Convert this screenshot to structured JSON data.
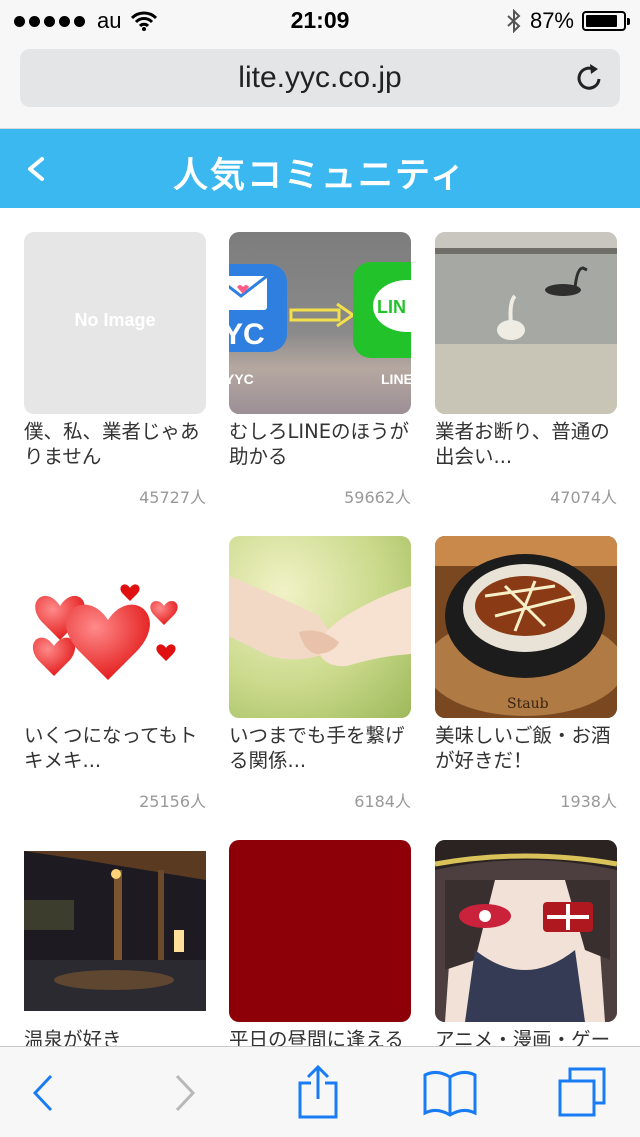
{
  "status": {
    "carrier": "au",
    "time": "21:09",
    "battery": "87%",
    "battery_level": 0.87
  },
  "browser": {
    "url": "lite.yyc.co.jp"
  },
  "header": {
    "title": "人気コミュニティ"
  },
  "communities": [
    {
      "name": "僕、私、業者じゃありません",
      "count": "45727人",
      "image": "no-image",
      "image_text": "No Image"
    },
    {
      "name": "むしろLINEのほうが助かる",
      "count": "59662人",
      "image": "yyc-to-line",
      "yyc_label": "YYC",
      "line_label": "LINE"
    },
    {
      "name": "業者お断り、普通の出会い...",
      "count": "47074人",
      "image": "swans-photo"
    },
    {
      "name": "いくつになってもトキメキ...",
      "count": "25156人",
      "image": "hearts"
    },
    {
      "name": "いつまでも手を繋げる関係...",
      "count": "6184人",
      "image": "holding-hands-photo"
    },
    {
      "name": "美味しいご飯・お酒が好きだ！",
      "count": "1938人",
      "image": "food-photo",
      "pot_text": "Staub"
    },
    {
      "name": "温泉が好き",
      "count": "",
      "image": "onsen-photo"
    },
    {
      "name": "平日の昼間に逢える",
      "count": "",
      "image": "dark-red"
    },
    {
      "name": "アニメ・漫画・ゲー",
      "count": "",
      "image": "anime-character"
    }
  ],
  "colors": {
    "header_bg": "#3bb8f0",
    "ios_blue": "#1a7cf5"
  }
}
